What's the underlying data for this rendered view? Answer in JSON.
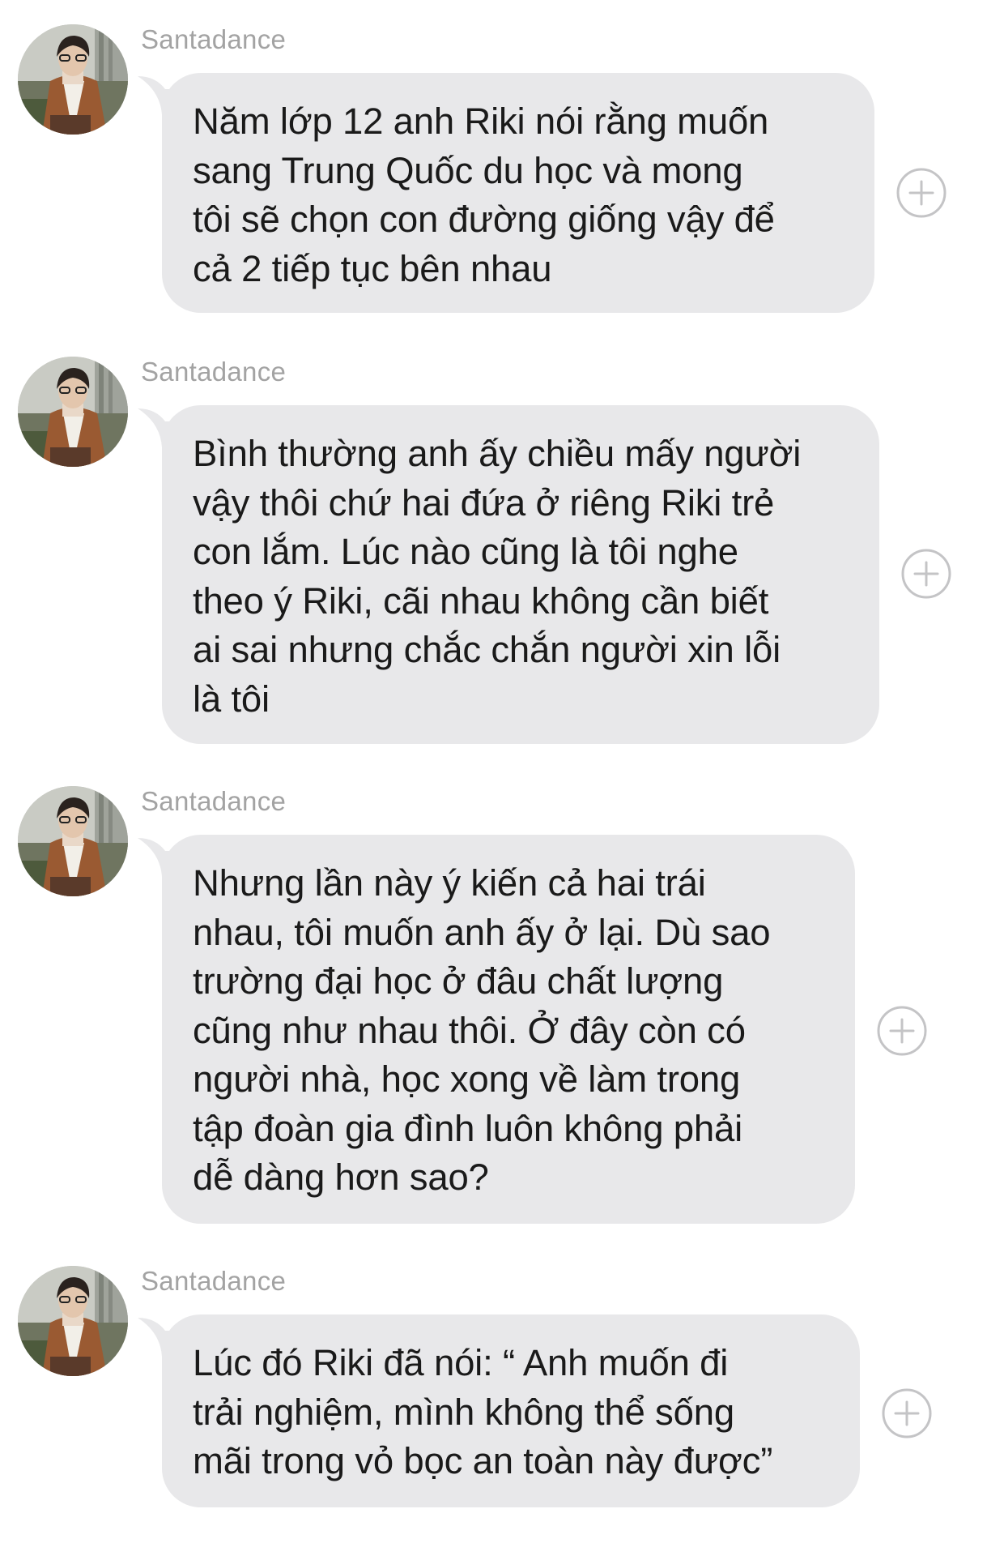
{
  "messages": [
    {
      "sender": "Santadance",
      "text": "Năm lớp 12 anh Riki nói rằng muốn\nsang Trung Quốc du học và mong\ntôi sẽ chọn con đường giống vậy để\ncả 2 tiếp tục bên nhau",
      "avatar_icon": "profile-photo",
      "reaction_icon": "add-reaction-icon"
    },
    {
      "sender": "Santadance",
      "text": "Bình thường anh ấy chiều mấy người\nvậy thôi chứ hai đứa ở riêng Riki trẻ\ncon lắm. Lúc nào cũng là tôi nghe\ntheo ý Riki, cãi nhau không cần biết\nai sai nhưng chắc chắn người xin lỗi\nlà tôi",
      "avatar_icon": "profile-photo",
      "reaction_icon": "add-reaction-icon"
    },
    {
      "sender": "Santadance",
      "text": "Nhưng lần này ý kiến cả hai trái\nnhau, tôi muốn anh ấy ở lại. Dù sao\ntrường đại học ở đâu chất lượng\ncũng như nhau thôi. Ở đây còn có\nngười nhà, học xong về làm trong\ntập đoàn gia đình luôn không phải\ndễ dàng hơn sao?",
      "avatar_icon": "profile-photo",
      "reaction_icon": "add-reaction-icon"
    },
    {
      "sender": "Santadance",
      "text": "Lúc đó Riki đã nói: “ Anh muốn đi\ntrải nghiệm, mình không thể sống\nmãi trong vỏ bọc an toàn này được”",
      "avatar_icon": "profile-photo",
      "reaction_icon": "add-reaction-icon"
    }
  ],
  "colors": {
    "bubble": "#e8e8ea",
    "text": "#1a1a1a",
    "sender": "#a3a3a3",
    "reaction": "#c4c4c6"
  }
}
